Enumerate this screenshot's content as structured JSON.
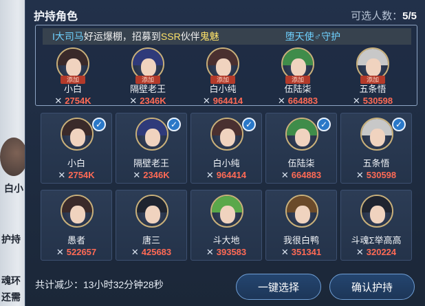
{
  "background": {
    "text_1": "白小",
    "text_2": "护持",
    "text_3": "魂环",
    "text_4": "还需"
  },
  "header": {
    "title": "护持角色",
    "selectable_label": "可选人数：",
    "selectable_count": "5/5"
  },
  "marquee": {
    "part1": "I大司马",
    "part2": "好运爆棚，招募到",
    "part3": "SSR",
    "part4": "伙伴",
    "part5": "鬼魅",
    "part6": "堕天使♂守护"
  },
  "selected": [
    {
      "name": "小白",
      "power": "2754K",
      "tag": "添加"
    },
    {
      "name": "隔壁老王",
      "power": "2346K",
      "tag": "添加"
    },
    {
      "name": "白小纯",
      "power": "964414",
      "tag": "添加"
    },
    {
      "name": "伍陆柒",
      "power": "664883",
      "tag": "添加"
    },
    {
      "name": "五条悟",
      "power": "530598",
      "tag": "添加"
    }
  ],
  "row1": [
    {
      "name": "小白",
      "power": "2754K",
      "checked": true
    },
    {
      "name": "隔壁老王",
      "power": "2346K",
      "checked": true
    },
    {
      "name": "白小纯",
      "power": "964414",
      "checked": true
    },
    {
      "name": "伍陆柒",
      "power": "664883",
      "checked": true
    },
    {
      "name": "五条悟",
      "power": "530598",
      "checked": true
    }
  ],
  "row2": [
    {
      "name": "愚者",
      "power": "522657"
    },
    {
      "name": "唐三",
      "power": "425683"
    },
    {
      "name": "斗大地",
      "power": "393583"
    },
    {
      "name": "我很白鸭",
      "power": "351341"
    },
    {
      "name": "斗魂Σ举高高",
      "power": "320224"
    }
  ],
  "check_glyph": "✓",
  "cross_glyph": "✕",
  "footer": {
    "text": "共计减少：13小时32分钟28秒"
  },
  "buttons": {
    "auto_select": "一键选择",
    "confirm": "确认护持"
  },
  "colors": {
    "power": "#ff6a55",
    "check": "#2a78c8",
    "accent_border": "#6f9fd6"
  }
}
